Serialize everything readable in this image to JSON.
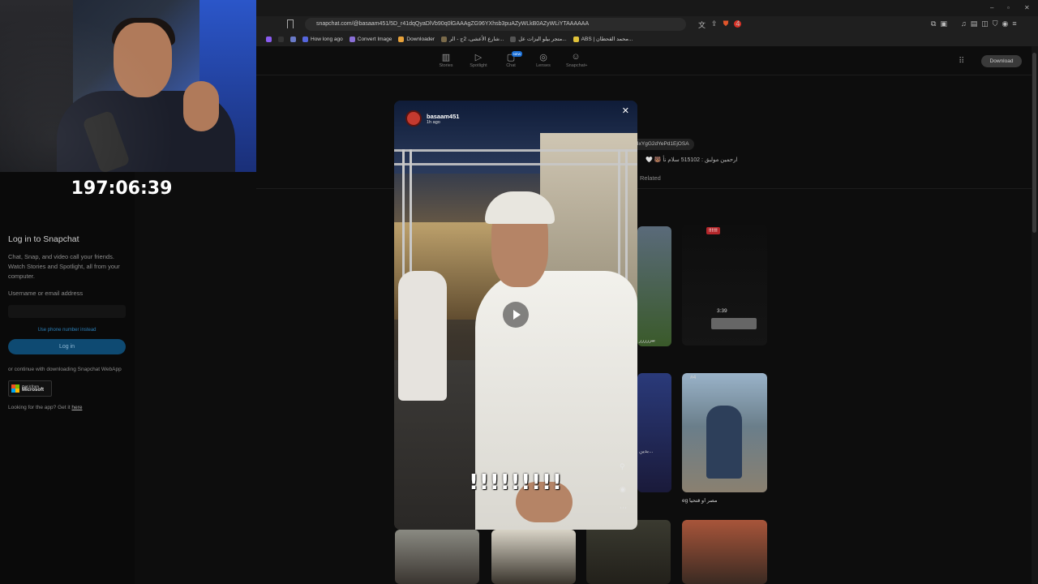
{
  "timer": "197:06:39",
  "browser": {
    "url": "snapchat.com/@basaam451/5D_r41dqQyaDlVb90q0lGAAAgZG96YXhsb3puAZyWLkB0AZyWLiYTAAAAAA",
    "notification_count": "4",
    "bookmarks": [
      {
        "label": "How long ago",
        "color": "#5566dd"
      },
      {
        "label": "Convert Image",
        "color": "#8a6fd6"
      },
      {
        "label": "Downloader",
        "color": "#e8a23a"
      },
      {
        "label": "شارع الأعشى، 2ج - الر...",
        "color": "#7a6a4a"
      },
      {
        "label": "متجر بيلو البزات عل...",
        "color": "#555555"
      },
      {
        "label": "ABS | محمد القحطان...",
        "color": "#e0c23a"
      }
    ]
  },
  "nav": {
    "items": [
      {
        "label": "Stories",
        "icon": "stories-icon"
      },
      {
        "label": "Spotlight",
        "icon": "spotlight-icon"
      },
      {
        "label": "Chat",
        "icon": "chat-icon"
      },
      {
        "label": "Lenses",
        "icon": "lenses-icon"
      },
      {
        "label": "Snapchat+",
        "icon": "snapchat-plus-icon"
      }
    ],
    "new_badge": "NEW",
    "download": "Download"
  },
  "login": {
    "title": "Log in to Snapchat",
    "description": "Chat, Snap, and video call your friends. Watch Stories and Spotlight, all from your computer.",
    "username_label": "Username or email address",
    "phone_link": "Use phone number instead",
    "login_button": "Log in",
    "continue_text": "or continue with downloading Snapchat WebApp",
    "ms_small": "Get it from",
    "ms_big": "Microsoft",
    "app_text": "Looking for the app? Get it ",
    "app_link": "here"
  },
  "profile": {
    "tag": "4xYgG2dYePd1EjOSA",
    "bio": "🤍 🐻 ارحمين مولبق : 515102 سلام نأ",
    "related": "Related",
    "captions": [
      "بيررررر",
      "#4",
      "eg مصر او قتحيا",
      "بدين..."
    ],
    "alarm_tag": "!!!!!!",
    "clock": "3:39"
  },
  "story": {
    "username": "basaam451",
    "time": "1h ago",
    "caption": "!!!!!!!!!"
  }
}
